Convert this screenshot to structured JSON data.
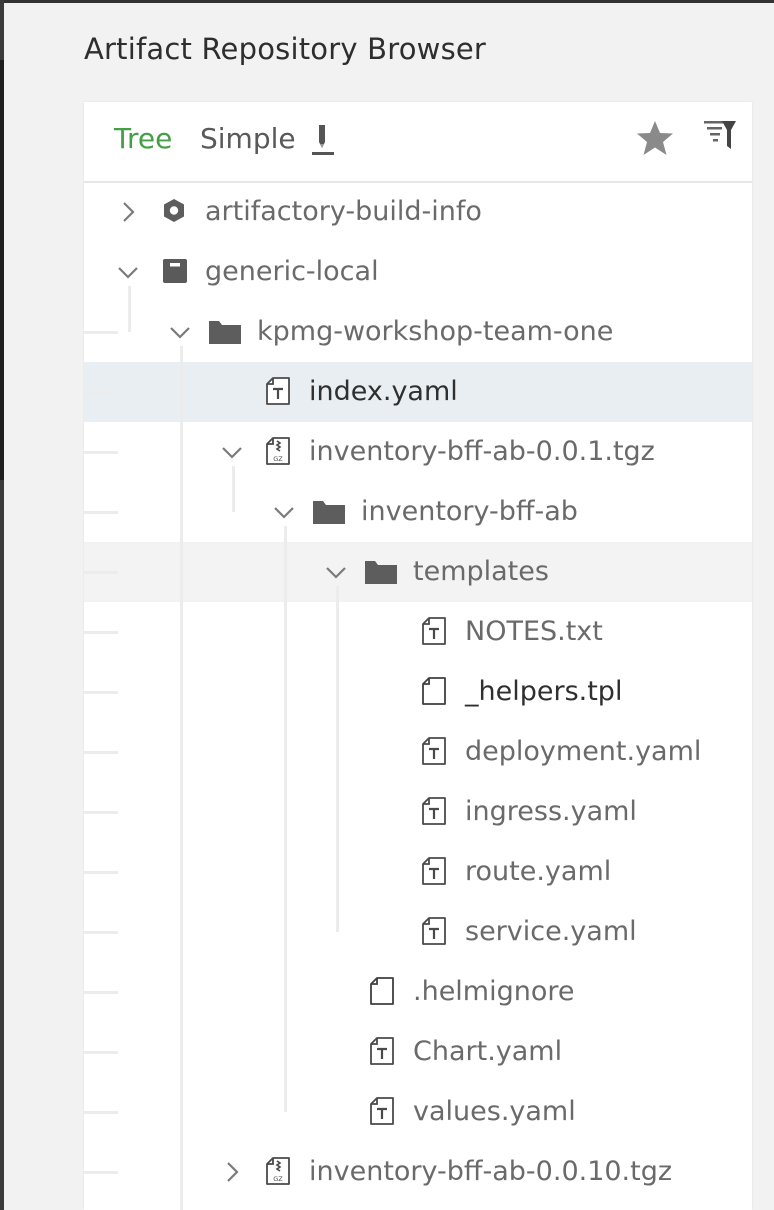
{
  "page": {
    "title": "Artifact Repository Browser"
  },
  "toolbar": {
    "tabs": [
      {
        "label": "Tree"
      },
      {
        "label": "Simple"
      }
    ],
    "icons": [
      "edit-pen-icon",
      "star-icon",
      "filter-icon"
    ]
  },
  "colors": {
    "active_tab": "#43a047",
    "selected_row": "#e8eef1",
    "hover_row": "#f3f3f3"
  },
  "tree": {
    "nodes": [
      {
        "label": "artifactory-build-info",
        "icon": "build-info-icon",
        "expanded": false
      },
      {
        "label": "generic-local",
        "icon": "repository-icon",
        "expanded": true
      },
      {
        "label": "kpmg-workshop-team-one",
        "icon": "folder-icon",
        "expanded": true
      },
      {
        "label": "index.yaml",
        "icon": "text-file-icon",
        "selected": true
      },
      {
        "label": "inventory-bff-ab-0.0.1.tgz",
        "icon": "gz-archive-icon",
        "expanded": true
      },
      {
        "label": "inventory-bff-ab",
        "icon": "folder-icon",
        "expanded": true
      },
      {
        "label": "templates",
        "icon": "folder-icon",
        "expanded": true,
        "hovered": true
      },
      {
        "label": "NOTES.txt",
        "icon": "text-file-icon"
      },
      {
        "label": "_helpers.tpl",
        "icon": "file-icon"
      },
      {
        "label": "deployment.yaml",
        "icon": "text-file-icon"
      },
      {
        "label": "ingress.yaml",
        "icon": "text-file-icon"
      },
      {
        "label": "route.yaml",
        "icon": "text-file-icon"
      },
      {
        "label": "service.yaml",
        "icon": "text-file-icon"
      },
      {
        "label": ".helmignore",
        "icon": "file-icon"
      },
      {
        "label": "Chart.yaml",
        "icon": "text-file-icon"
      },
      {
        "label": "values.yaml",
        "icon": "text-file-icon"
      },
      {
        "label": "inventory-bff-ab-0.0.10.tgz",
        "icon": "gz-archive-icon",
        "expanded": false
      }
    ]
  }
}
